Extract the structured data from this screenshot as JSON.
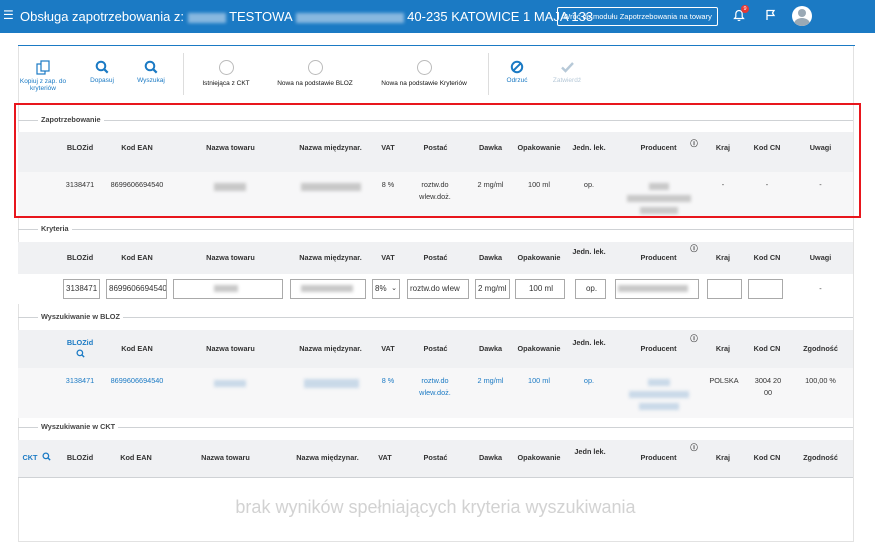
{
  "header": {
    "menu_icon": "hamburger-icon",
    "title_prefix": "Obsługa zapotrzebowania z:",
    "title_mid": "TESTOWA",
    "title_suffix": "40-235 KATOWICE 1 MAJA 133",
    "back_button": "Wróć do modułu Zapotrzebowania na towary",
    "notification_count": "9",
    "brand_color": "#1b7ac4"
  },
  "toolbar": {
    "copy": "Kopiuj z zap. do kryteriów",
    "match": "Dopasuj",
    "search": "Wyszukaj",
    "opt_ckt": "Istniejąca z CKT",
    "opt_bloz": "Nowa na podstawie BLOZ",
    "opt_criteria": "Nowa na podstawie Kryteriów",
    "reject": "Odrzuć",
    "approve": "Zatwierdź"
  },
  "demand": {
    "section": "Zapotrzebowanie",
    "headers": {
      "bloz": "BLOZid",
      "ean": "Kod EAN",
      "name": "Nazwa towaru",
      "intl": "Nazwa międzynar.",
      "vat": "VAT",
      "form": "Postać",
      "dose": "Dawka",
      "pack": "Opakowanie",
      "unit": "Jedn. lek.",
      "producer": "Producent",
      "country": "Kraj",
      "cn": "Kod CN",
      "notes": "Uwagi"
    },
    "row": {
      "bloz": "3138471",
      "ean": "8699606694540",
      "vat": "8 %",
      "form": "roztw.do wlew.doż.",
      "dose": "2 mg/ml",
      "pack": "100 ml",
      "unit": "op.",
      "country": "-",
      "cn": "-",
      "notes": "-"
    }
  },
  "criteria": {
    "section": "Kryteria",
    "headers": {
      "bloz": "BLOZid",
      "ean": "Kod EAN",
      "name": "Nazwa towaru",
      "intl": "Nazwa międzynar.",
      "vat": "VAT",
      "form": "Postać",
      "dose": "Dawka",
      "pack": "Opakowanie",
      "unit": "Jedn. lek.",
      "producer": "Producent",
      "country": "Kraj",
      "cn": "Kod CN",
      "notes": "Uwagi"
    },
    "inputs": {
      "bloz": "3138471",
      "ean": "8699606694540",
      "vat": "8%",
      "form": "roztw.do wlew",
      "dose": "2 mg/ml",
      "pack": "100 ml",
      "unit": "op.",
      "notes": "-"
    }
  },
  "bloz": {
    "section": "Wyszukiwanie w BLOZ",
    "headers": {
      "bloz": "BLOZid",
      "ean": "Kod EAN",
      "name": "Nazwa towaru",
      "intl": "Nazwa międzynar.",
      "vat": "VAT",
      "form": "Postać",
      "dose": "Dawka",
      "pack": "Opakowanie",
      "unit": "Jedn. lek.",
      "producer": "Producent",
      "country": "Kraj",
      "cn": "Kod CN",
      "match": "Zgodność"
    },
    "row": {
      "bloz": "3138471",
      "ean": "8699606694540",
      "vat": "8 %",
      "form": "roztw.do wlew.doż.",
      "dose": "2 mg/ml",
      "pack": "100 ml",
      "unit": "op.",
      "country": "POLSKA",
      "cn": "3004 20 00",
      "match": "100,00 %"
    }
  },
  "ckt": {
    "section": "Wyszukiwanie w CKT",
    "headers": {
      "ckt": "CKT",
      "bloz": "BLOZid",
      "ean": "Kod EAN",
      "name": "Nazwa towaru",
      "intl": "Nazwa międzynar.",
      "vat": "VAT",
      "form": "Postać",
      "dose": "Dawka",
      "pack": "Opakowanie",
      "unit": "Jedn lek.",
      "producer": "Producent",
      "country": "Kraj",
      "cn": "Kod CN",
      "match": "Zgodność"
    },
    "empty": "brak wyników spełniających kryteria wyszukiwania"
  }
}
